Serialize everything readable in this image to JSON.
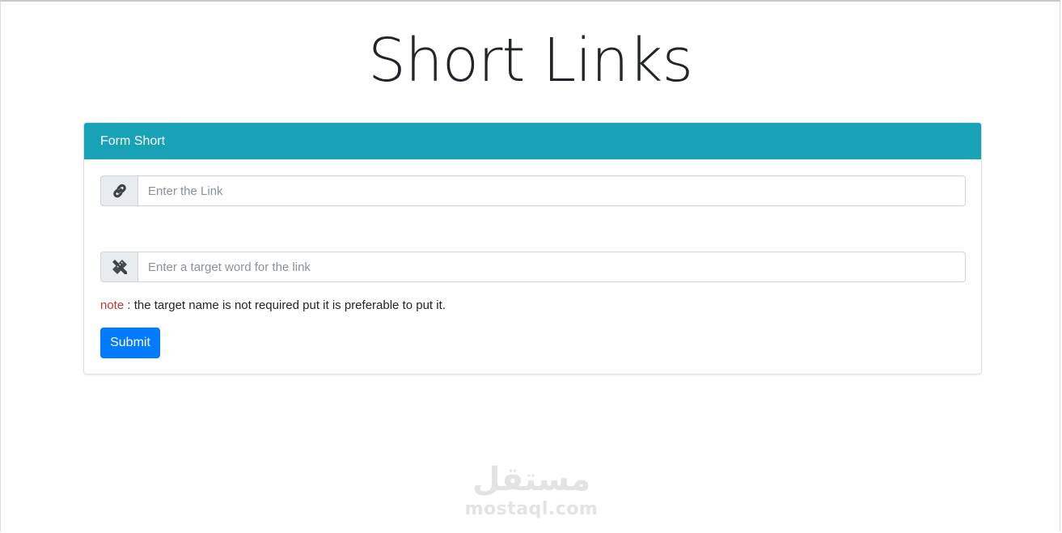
{
  "page": {
    "title": "Short Links"
  },
  "form": {
    "header": "Form Short",
    "link_input": {
      "placeholder": "Enter the Link",
      "value": "",
      "icon": "link-icon"
    },
    "target_input": {
      "placeholder": "Enter a target word for the link",
      "value": "",
      "icon": "pencil-ruler-icon"
    },
    "note": {
      "label": "note",
      "text": " : the target name is not required put it is preferable to put it."
    },
    "submit_label": "Submit"
  },
  "watermark": {
    "logo_text": "مستقل",
    "url": "mostaql.com"
  },
  "colors": {
    "header_bg": "#17a2b8",
    "primary": "#007bff",
    "note_label": "#c0392b"
  }
}
